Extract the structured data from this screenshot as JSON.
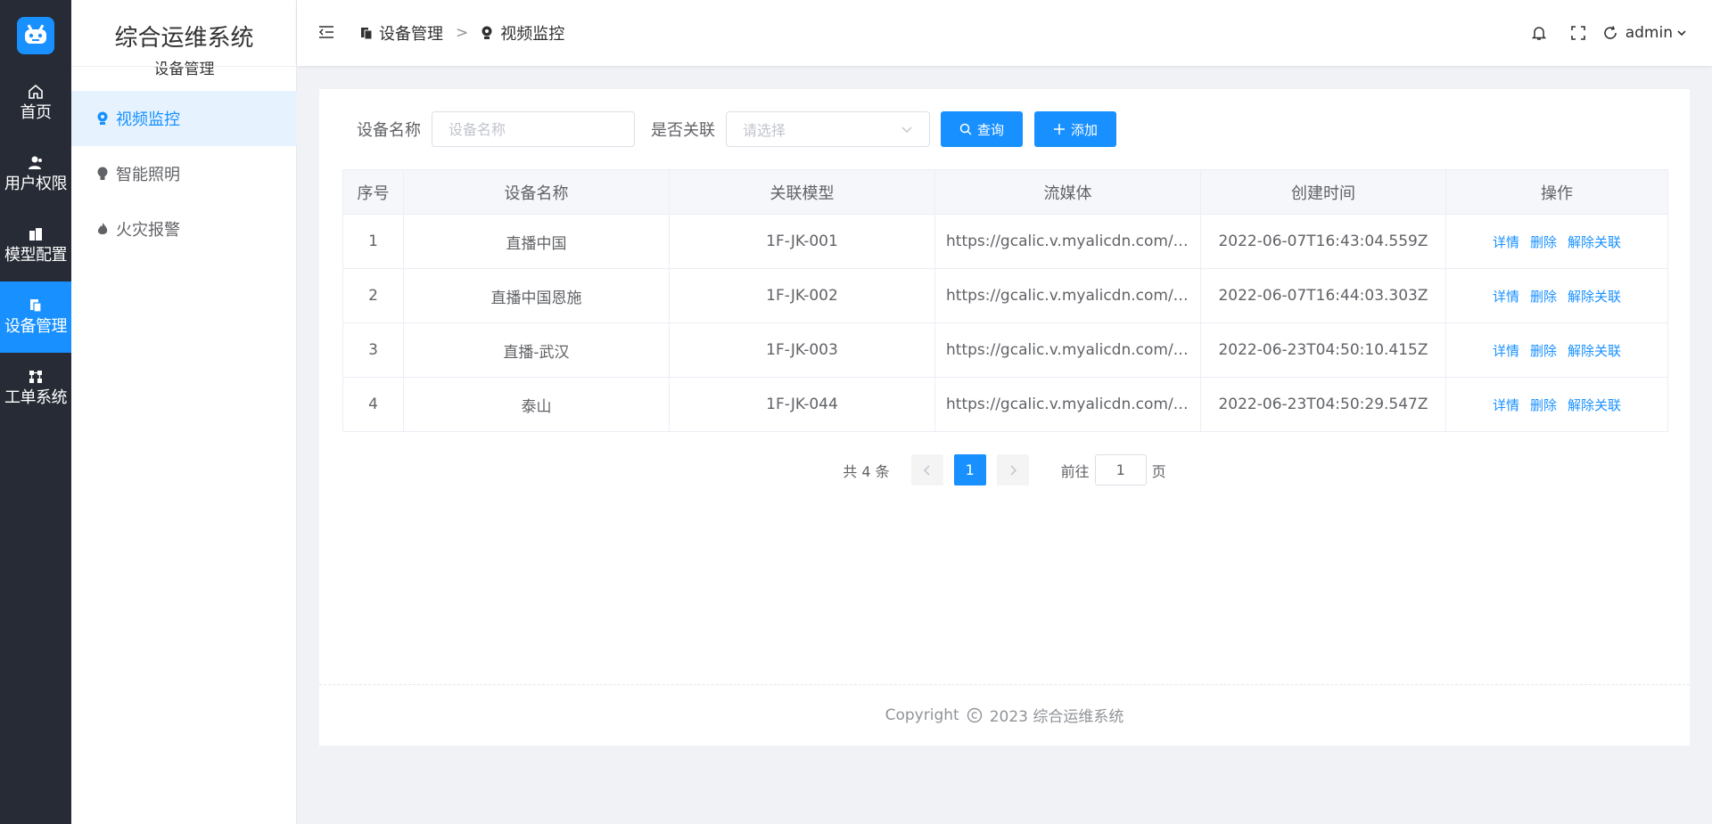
{
  "app": {
    "title": "综合运维系统",
    "subtitle": "设备管理"
  },
  "rail": {
    "items": [
      {
        "label": "首页",
        "icon": "home-icon"
      },
      {
        "label": "用户权限",
        "icon": "users-icon"
      },
      {
        "label": "模型配置",
        "icon": "building-icon"
      },
      {
        "label": "设备管理",
        "icon": "device-icon",
        "active": true
      },
      {
        "label": "工单系统",
        "icon": "workflow-icon"
      }
    ]
  },
  "sidebar": {
    "items": [
      {
        "label": "视频监控",
        "icon": "camera-icon",
        "active": true
      },
      {
        "label": "智能照明",
        "icon": "bulb-icon"
      },
      {
        "label": "火灾报警",
        "icon": "flame-icon"
      }
    ]
  },
  "header": {
    "breadcrumb": [
      {
        "label": "设备管理",
        "icon": "device-icon"
      },
      {
        "label": "视频监控",
        "icon": "camera-icon"
      }
    ],
    "separator": ">",
    "user": "admin"
  },
  "filter": {
    "name_label": "设备名称",
    "name_placeholder": "设备名称",
    "linked_label": "是否关联",
    "linked_placeholder": "请选择",
    "search_label": "查询",
    "add_label": "添加"
  },
  "table": {
    "columns": [
      "序号",
      "设备名称",
      "关联模型",
      "流媒体",
      "创建时间",
      "操作"
    ],
    "rows": [
      {
        "index": "1",
        "name": "直播中国",
        "model": "1F-JK-001",
        "stream": "https://gcalic.v.myalicdn.com/gc/...",
        "created": "2022-06-07T16:43:04.559Z"
      },
      {
        "index": "2",
        "name": "直播中国恩施",
        "model": "1F-JK-002",
        "stream": "https://gcalic.v.myalicdn.com/gc/...",
        "created": "2022-06-07T16:44:03.303Z"
      },
      {
        "index": "3",
        "name": "直播-武汉",
        "model": "1F-JK-003",
        "stream": "https://gcalic.v.myalicdn.com/gc/...",
        "created": "2022-06-23T04:50:10.415Z"
      },
      {
        "index": "4",
        "name": "泰山",
        "model": "1F-JK-044",
        "stream": "https://gcalic.v.myalicdn.com/gc/...",
        "created": "2022-06-23T04:50:29.547Z"
      }
    ],
    "actions": {
      "detail": "详情",
      "delete": "删除",
      "unlink": "解除关联"
    }
  },
  "pagination": {
    "total": "共 4 条",
    "current": "1",
    "goto_prefix": "前往",
    "goto_value": "1",
    "goto_suffix": "页"
  },
  "footer": {
    "copyright": "Copyright",
    "text": "2023 综合运维系统"
  },
  "colors": {
    "primary": "#1890ff",
    "rail_bg": "#262b35",
    "active_bg": "#e6f3ff"
  }
}
